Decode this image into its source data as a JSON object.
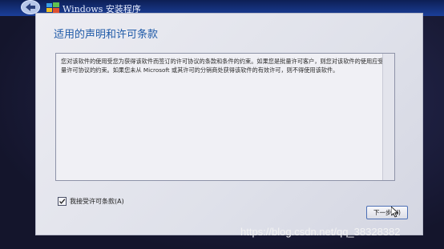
{
  "window": {
    "title": "Windows 安装程序"
  },
  "page": {
    "heading": "适用的声明和许可条款",
    "license_text": "您对该软件的使用受您为获得该软件而签订的许可协议的条款和条件的约束。如果您是批量许可客户，则您对该软件的使用应受批量许可协议的约束。如果您未从 Microsoft 或其许可的分销商处获得该软件的有效许可，则不得使用该软件。",
    "accept_label": "我接受许可条款(A)",
    "accept_checked": true,
    "next_label": "下一步(N)"
  },
  "watermark": "https://blog.csdn.net/qq_38328382",
  "colors": {
    "heading": "#1f5aa8",
    "titlebar": "#1b3f9a",
    "panel": "#e6e7ee"
  }
}
